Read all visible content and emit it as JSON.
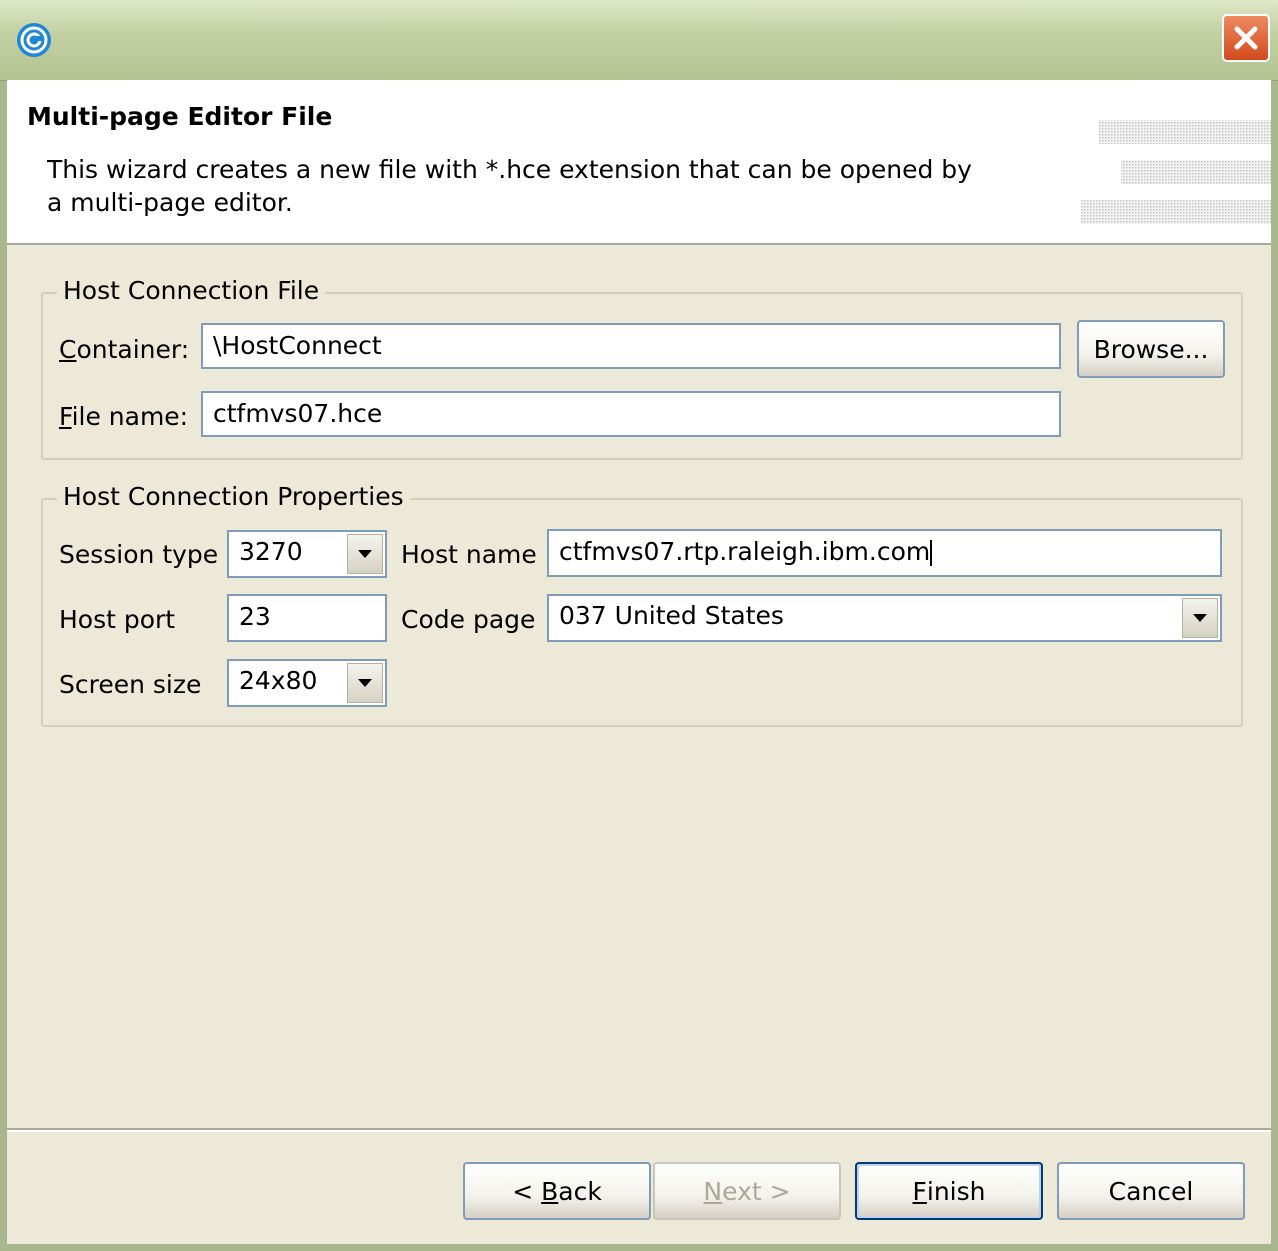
{
  "colors": {
    "titlebar": "#c3d1a4",
    "close_button": "#d24a1c",
    "dialog_bg": "#ece9d8",
    "field_border": "#7f9db9",
    "button_border": "#003c74"
  },
  "header": {
    "title": "Multi-page Editor File",
    "description": "This wizard creates a new file with *.hce extension that can be opened by a multi-page editor."
  },
  "host_connection_file": {
    "legend": "Host Connection File",
    "container_label_mnemonic": "C",
    "container_label_rest": "ontainer:",
    "container_value": "\\HostConnect",
    "browse_label": "Browse...",
    "file_name_label_mnemonic": "F",
    "file_name_label_rest": "ile name:",
    "file_name_value": "ctfmvs07.hce"
  },
  "host_connection_properties": {
    "legend": "Host Connection Properties",
    "session_type_label": "Session type",
    "session_type_value": "3270",
    "host_name_label": "Host name",
    "host_name_value": "ctfmvs07.rtp.raleigh.ibm.com",
    "host_port_label": "Host port",
    "host_port_value": "23",
    "code_page_label": "Code page",
    "code_page_value": "037 United States",
    "screen_size_label": "Screen size",
    "screen_size_value": "24x80"
  },
  "buttons": {
    "back_prefix": "< ",
    "back_mnemonic": "B",
    "back_rest": "ack",
    "next_mnemonic": "N",
    "next_rest": "ext >",
    "finish_mnemonic": "F",
    "finish_rest": "inish",
    "cancel": "Cancel"
  },
  "icons": {
    "app": "eclipse-swirl-icon",
    "close": "close-icon",
    "dropdown": "chevron-down-icon"
  }
}
